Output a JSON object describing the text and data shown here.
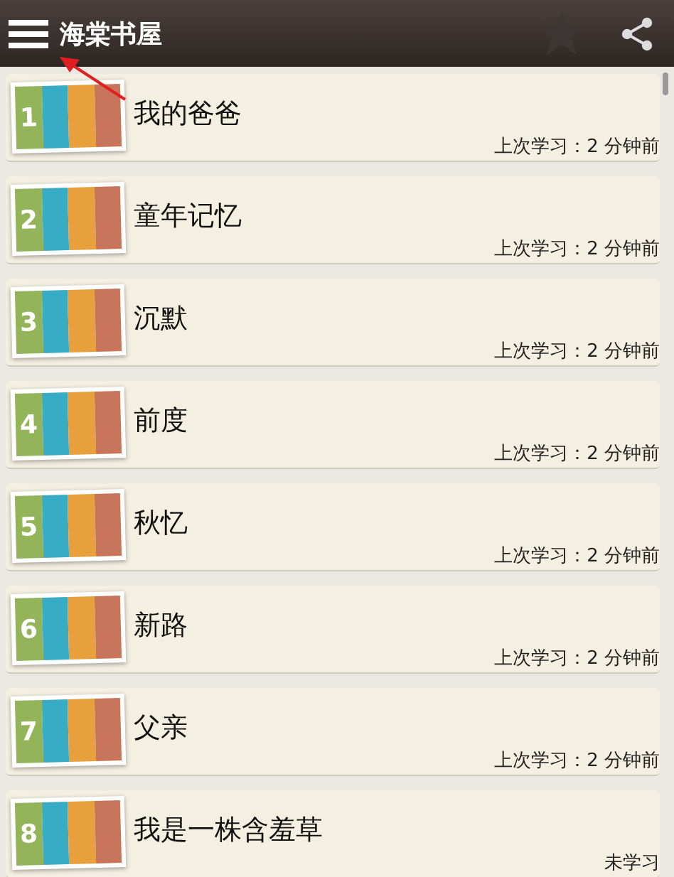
{
  "app_bar": {
    "title": "海棠书屋"
  },
  "lessons": [
    {
      "number": "1",
      "title": "我的爸爸",
      "last_studied": "上次学习：2 分钟前"
    },
    {
      "number": "2",
      "title": "童年记忆",
      "last_studied": "上次学习：2 分钟前"
    },
    {
      "number": "3",
      "title": "沉默",
      "last_studied": "上次学习：2 分钟前"
    },
    {
      "number": "4",
      "title": "前度",
      "last_studied": "上次学习：2 分钟前"
    },
    {
      "number": "5",
      "title": "秋忆",
      "last_studied": "上次学习：2 分钟前"
    },
    {
      "number": "6",
      "title": "新路",
      "last_studied": "上次学习：2 分钟前"
    },
    {
      "number": "7",
      "title": "父亲",
      "last_studied": "上次学习：2 分钟前"
    },
    {
      "number": "8",
      "title": "我是一株含羞草",
      "last_studied": "未学习"
    }
  ]
}
